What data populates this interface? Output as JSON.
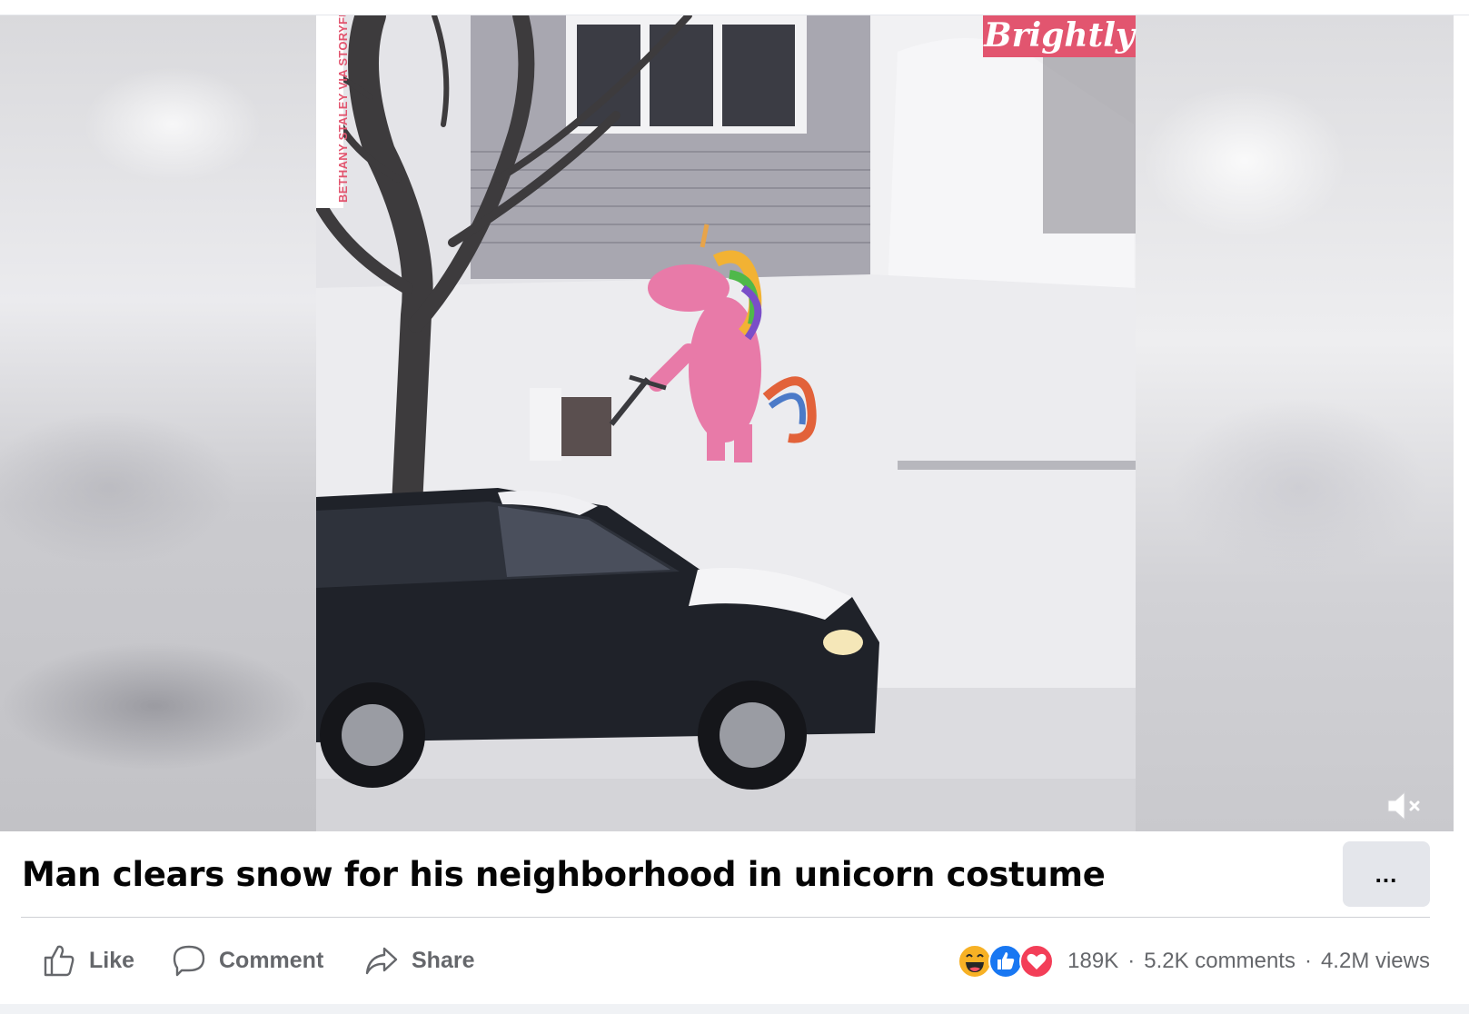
{
  "video": {
    "watermark": "Brightly",
    "credit": "BETHANY STALEY VIA STORYFUL",
    "muted": true
  },
  "post": {
    "title": "Man clears snow for his neighborhood in unicorn costume",
    "more_label": "..."
  },
  "actions": {
    "like_label": "Like",
    "comment_label": "Comment",
    "share_label": "Share"
  },
  "stats": {
    "reaction_count": "189K",
    "separator": "·",
    "comments": "5.2K comments",
    "views": "4.2M views"
  },
  "colors": {
    "brand_pink": "#e2556f",
    "like_blue": "#1877f2",
    "love_red": "#f33e58",
    "haha_yellow": "#f7b125",
    "muted_text": "#65676b"
  }
}
